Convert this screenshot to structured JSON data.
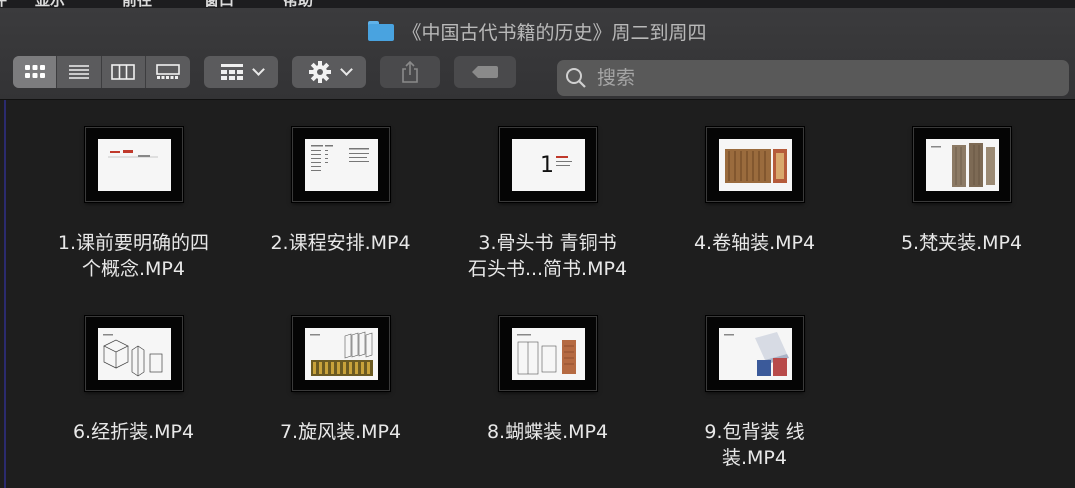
{
  "menubar": {
    "items": [
      "件",
      "显示",
      "前往",
      "窗口",
      "帮助"
    ]
  },
  "window": {
    "title": "《中国古代书籍的历史》周二到周四",
    "folder_color": "#49a3e0"
  },
  "toolbar": {
    "view_modes": [
      "icon-view",
      "list-view",
      "column-view",
      "gallery-view"
    ],
    "active_view": "icon-view",
    "group_button_icon": "grid-group-icon",
    "action_button_icon": "gear-icon",
    "share_button_icon": "share-icon",
    "tag_button_icon": "tag-icon"
  },
  "search": {
    "placeholder": "搜索"
  },
  "files": [
    {
      "name_line1": "1.课前要明确的四",
      "name_line2": "个概念.MP4",
      "thumb": "title-slide"
    },
    {
      "name_line1": "2.课程安排.MP4",
      "name_line2": "",
      "thumb": "text-table"
    },
    {
      "name_line1": "3.骨头书 青铜书",
      "name_line2": "石头书...简书.MP4",
      "thumb": "number-slide",
      "thumb_text": "1"
    },
    {
      "name_line1": "4.卷轴装.MP4",
      "name_line2": "",
      "thumb": "scroll-photo"
    },
    {
      "name_line1": "5.梵夹装.MP4",
      "name_line2": "",
      "thumb": "palm-leaf"
    },
    {
      "name_line1": "6.经折装.MP4",
      "name_line2": "",
      "thumb": "folded-sketch"
    },
    {
      "name_line1": "7.旋风装.MP4",
      "name_line2": "",
      "thumb": "whirlwind"
    },
    {
      "name_line1": "8.蝴蝶装.MP4",
      "name_line2": "",
      "thumb": "butterfly"
    },
    {
      "name_line1": "9.包背装 线",
      "name_line2": "装.MP4",
      "thumb": "bound-books"
    }
  ]
}
